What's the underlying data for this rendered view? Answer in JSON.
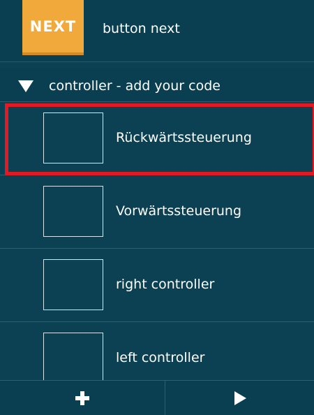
{
  "next_row": {
    "button_text": "NEXT",
    "label": "button next"
  },
  "group": {
    "label": "controller - add your code",
    "icon": "triangle-down-icon"
  },
  "items": [
    {
      "label": "Rückwärtssteuerung",
      "selected": true
    },
    {
      "label": "Vorwärtssteuerung",
      "selected": false
    },
    {
      "label": "right controller",
      "selected": false
    },
    {
      "label": "left controller",
      "selected": false
    }
  ],
  "footer": {
    "add_icon": "plus-icon",
    "play_icon": "play-icon"
  },
  "colors": {
    "panel_bg": "#0b4153",
    "accent": "#f2a93b",
    "selection": "#e31a24",
    "text": "#ffffff"
  }
}
